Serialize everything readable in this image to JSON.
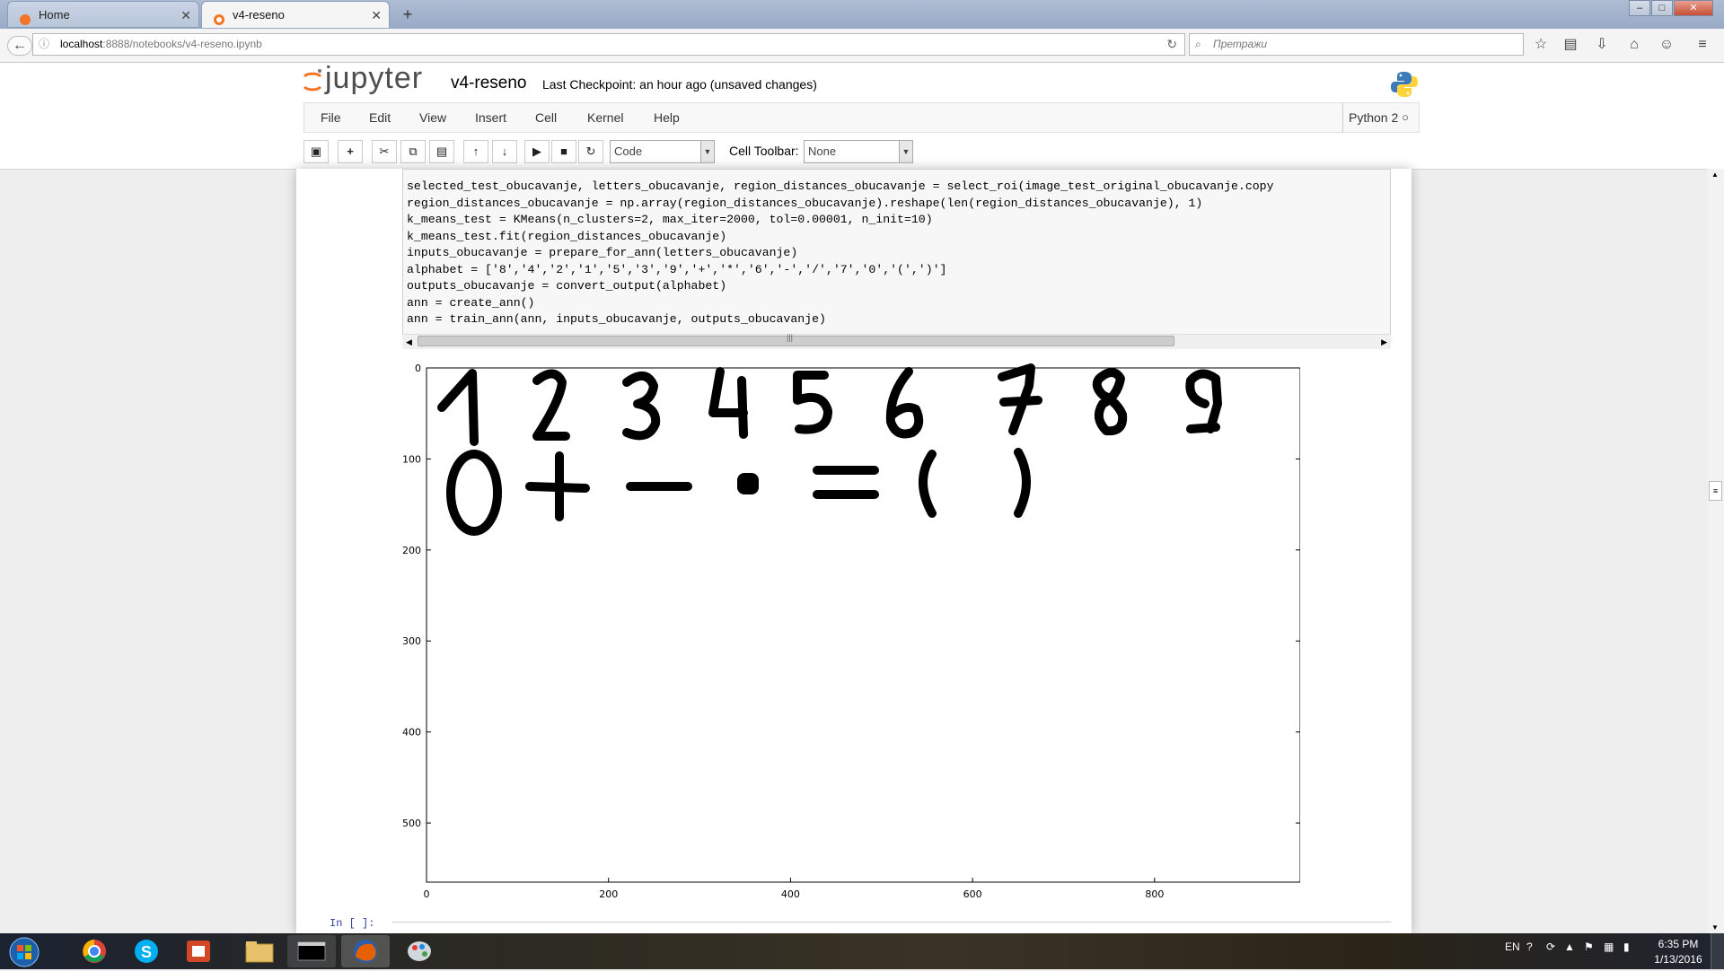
{
  "browser": {
    "tabs": [
      {
        "title": "Home",
        "active": false
      },
      {
        "title": "v4-reseno",
        "active": true
      }
    ],
    "new_tab": "+",
    "url_host": "localhost",
    "url_rest": ":8888/notebooks/v4-reseno.ipynb",
    "search_placeholder": "Претражи",
    "window_buttons": [
      "–",
      "□",
      "✕"
    ]
  },
  "jupyter": {
    "logo_text": "jupyter",
    "notebook_name": "v4-reseno",
    "checkpoint": "Last Checkpoint: an hour ago (unsaved changes)",
    "menu": [
      "File",
      "Edit",
      "View",
      "Insert",
      "Cell",
      "Kernel",
      "Help"
    ],
    "kernel": "Python 2",
    "toolbar": {
      "cell_type": "Code",
      "cell_toolbar_label": "Cell Toolbar:",
      "cell_toolbar_value": "None"
    }
  },
  "code": {
    "lines": [
      "selected_test_obucavanje, letters_obucavanje, region_distances_obucavanje = select_roi(image_test_original_obucavanje.copy",
      "region_distances_obucavanje = np.array(region_distances_obucavanje).reshape(len(region_distances_obucavanje), 1)",
      "k_means_test = KMeans(n_clusters=2, max_iter=2000, tol=0.00001, n_init=10)",
      "k_means_test.fit(region_distances_obucavanje)",
      "inputs_obucavanje = prepare_for_ann(letters_obucavanje)",
      "alphabet = ['8','4','2','1','5','3','9','+','*','6','-','/','7','0','(',')']",
      "outputs_obucavanje = convert_output(alphabet)",
      "ann = create_ann()",
      "ann = train_ann(ann, inputs_obucavanje, outputs_obucavanje)"
    ],
    "scroll_grip": "|||"
  },
  "chart_data": {
    "type": "image",
    "title": "",
    "xlabel": "",
    "ylabel": "",
    "xlim": [
      0,
      960
    ],
    "ylim": [
      565,
      0
    ],
    "xticks": [
      0,
      200,
      400,
      600,
      800
    ],
    "yticks": [
      0,
      100,
      200,
      300,
      400,
      500
    ],
    "image_content_rows": [
      [
        "1",
        "2",
        "3",
        "4",
        "5",
        "6",
        "7",
        "8",
        "9"
      ],
      [
        "0",
        "+",
        "−",
        "•",
        "=",
        "(",
        ")"
      ]
    ]
  },
  "output_prompt": "In [ ]:",
  "taskbar": {
    "lang": "EN",
    "time": "6:35 PM",
    "date": "1/13/2016"
  }
}
